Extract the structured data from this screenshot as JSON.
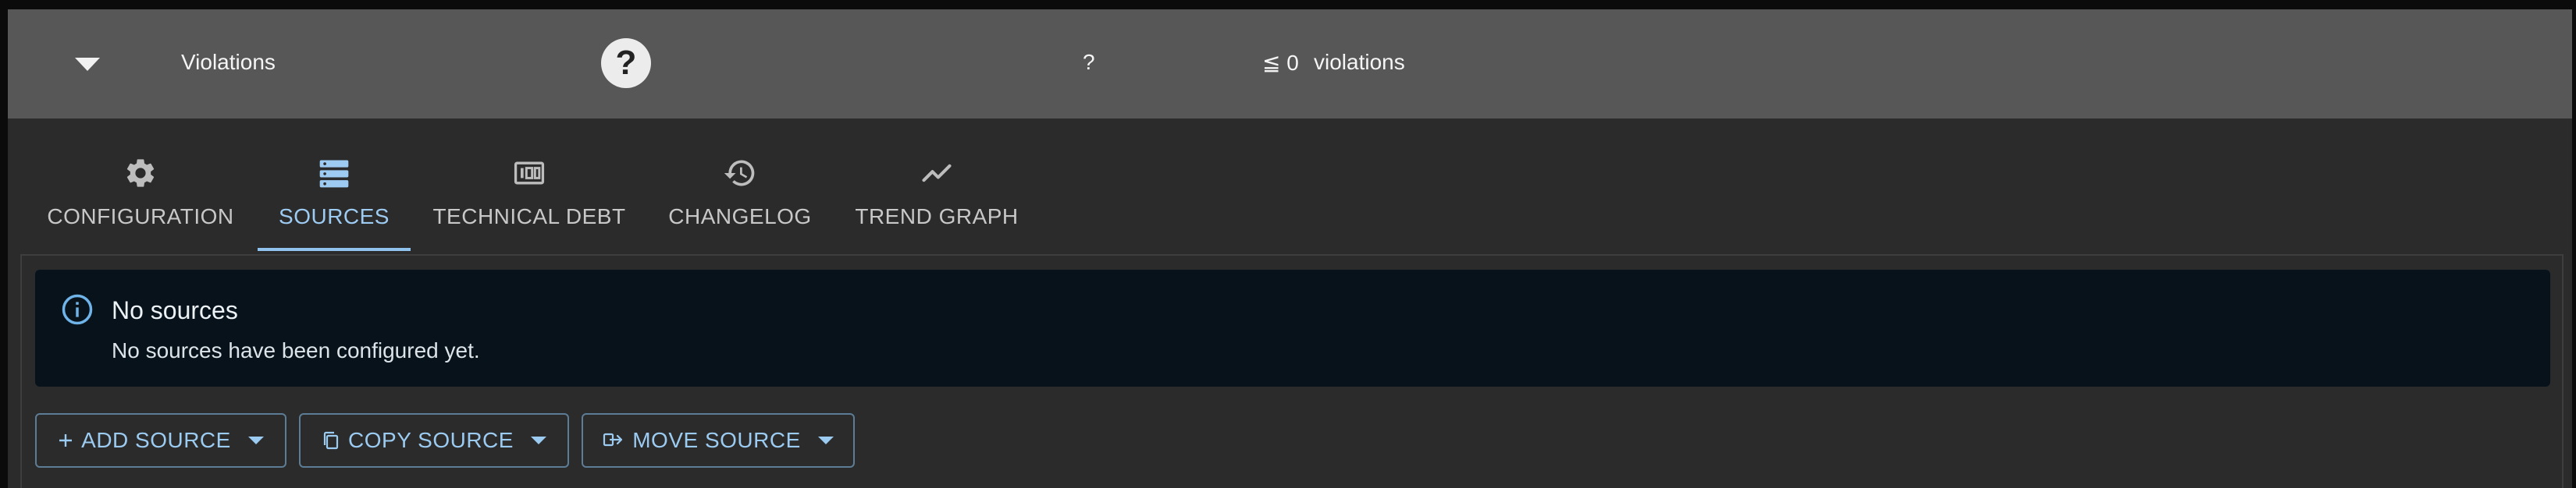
{
  "header": {
    "metric_name": "Violations",
    "help_symbol": "?",
    "measurement_value": "?",
    "target": "≦ 0",
    "unit": "violations"
  },
  "tabs": [
    {
      "label": "CONFIGURATION",
      "icon": "gear-icon",
      "active": false
    },
    {
      "label": "SOURCES",
      "icon": "server-icon",
      "active": true
    },
    {
      "label": "TECHNICAL DEBT",
      "icon": "money-icon",
      "active": false
    },
    {
      "label": "CHANGELOG",
      "icon": "history-icon",
      "active": false
    },
    {
      "label": "TREND GRAPH",
      "icon": "chart-line-icon",
      "active": false
    }
  ],
  "alert": {
    "title": "No sources",
    "message": "No sources have been configured yet."
  },
  "actions": {
    "add_source": "ADD SOURCE",
    "copy_source": "COPY SOURCE",
    "move_source": "MOVE SOURCE"
  },
  "colors": {
    "header_bg": "#575757",
    "panel_bg": "#2b2b2b",
    "accent": "#9ecbf2",
    "alert_bg": "#07121a"
  }
}
